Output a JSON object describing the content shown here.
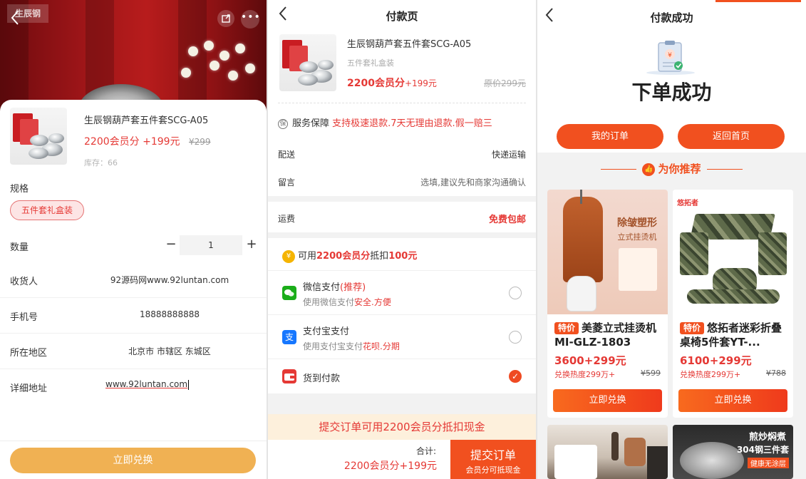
{
  "exchange_sheet": {
    "watermark": "生辰钢",
    "product_name": "生辰钢葫芦套五件套SCG-A05",
    "price_points": "2200会员分",
    "price_cash": "+199元",
    "old_price": "¥299",
    "stock": "库存：66",
    "spec_label": "规格",
    "spec_option": "五件套礼盒装",
    "quantity_label": "数量",
    "quantity_value": "1",
    "minus_glyph": "−",
    "plus_glyph": "+",
    "consignee_label": "收货人",
    "consignee_value": "92源码网www.92luntan.com",
    "phone_label": "手机号",
    "phone_value": "18888888888",
    "region_label": "所在地区",
    "region_value": "北京市 市辖区 东城区",
    "address_label": "详细地址",
    "address_value": "www.92luntan.com",
    "submit_label": "立即兑换"
  },
  "checkout": {
    "title": "付款页",
    "product_name": "生辰钢葫芦套五件套SCG-A05",
    "spec": "五件套礼盒装",
    "price_points": "2200会员分",
    "price_cash": "+199元",
    "old_price_label": "原价",
    "old_price": "299元",
    "service_label": "服务保障",
    "service_text": "支持极速退款.7天无理由退款.假一赔三",
    "delivery_label": "配送",
    "delivery_value": "快递运输",
    "note_label": "留言",
    "note_placeholder": "选填,建议先和商家沟通确认",
    "shipping_label": "运费",
    "shipping_value": "免费包邮",
    "points_prefix": "可用",
    "points_amount": "2200会员分",
    "points_mid": "抵扣",
    "points_value": "100元",
    "wechat_name": "微信支付",
    "wechat_tag": "(推荐)",
    "wechat_desc_prefix": "使用微信支付",
    "wechat_desc_hl": "安全.方便",
    "alipay_name": "支付宝支付",
    "alipay_desc_prefix": "使用支付宝支付",
    "alipay_desc_hl": "花呗.分期",
    "cod_name": "货到付款",
    "banner": "提交订单可用2200会员分抵扣现金",
    "total_label": "合计:",
    "total_value": "2200会员分+199元",
    "submit_label": "提交订单",
    "submit_sub": "会员分可抵现金"
  },
  "success": {
    "title": "付款成功",
    "headline": "下单成功",
    "my_orders": "我的订单",
    "back_home": "返回首页",
    "recommend": "为你推荐",
    "products": [
      {
        "tag": "特价",
        "name": "美菱立式挂烫机MI-GLZ-1803",
        "price": "3600+299元",
        "sub": "兑换热度299万+",
        "old": "¥599",
        "button": "立即兑换",
        "banner_text": "除皱塑形",
        "banner_sub": "立式挂烫机"
      },
      {
        "tag": "特价",
        "name": "悠拓者迷彩折叠桌椅5件套YT-...",
        "price": "6100+299元",
        "sub": "兑换热度299万+",
        "old": "¥788",
        "button": "立即兑换",
        "banner_text": "悠拓者"
      }
    ],
    "partial_banner": "煎炒焖煮",
    "partial_sub": "304钢三件套",
    "partial_note": "健康无涂层"
  },
  "colors": {
    "accent": "#f1501f",
    "price_red": "#e53935",
    "exchange_button": "#f0b153",
    "banner_bg": "#fdf0dc",
    "hero_red": "#9c1518"
  },
  "icons": {
    "back": "chevron-left-icon",
    "share": "share-icon",
    "more": "more-icon",
    "service": "shield-icon",
    "coin": "coin-icon",
    "wechat": "wechat-pay-icon",
    "alipay": "alipay-icon",
    "cod": "wallet-icon",
    "check": "check-icon",
    "thumb": "thumbs-up-icon",
    "clipboard": "clipboard-success-icon"
  }
}
